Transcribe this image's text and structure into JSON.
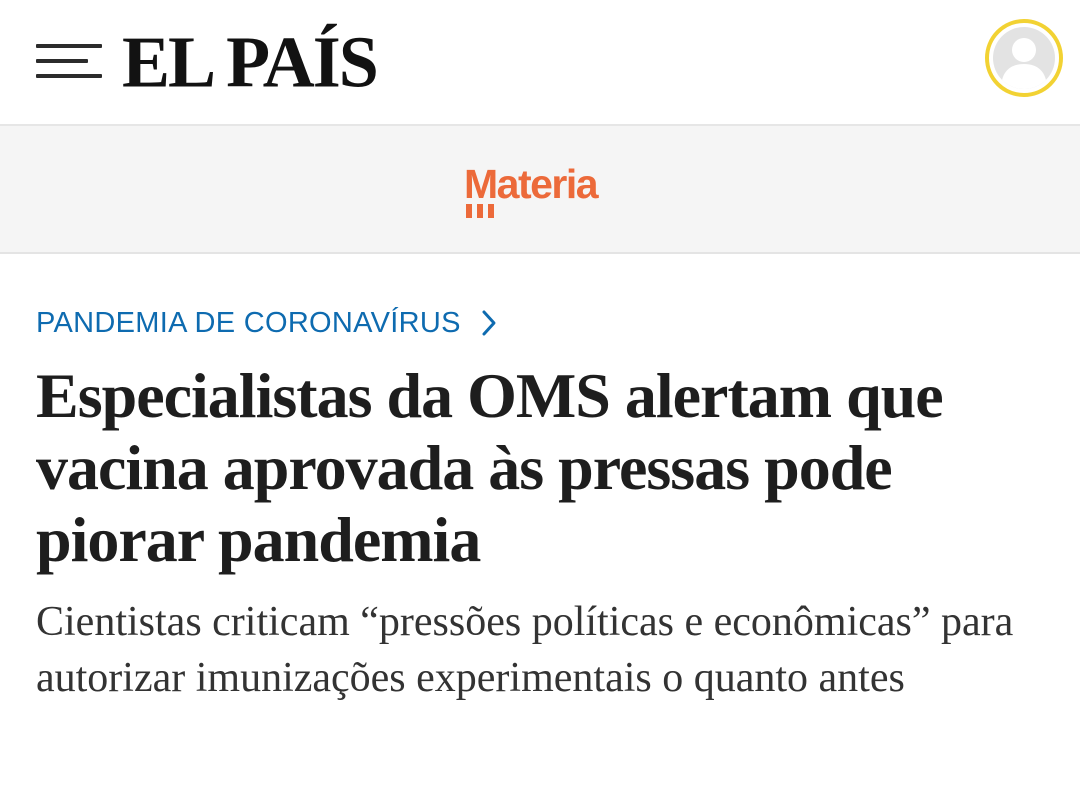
{
  "header": {
    "logo_text": "EL PAÍS",
    "menu_icon": "hamburger-menu-icon",
    "avatar_icon": "user-avatar-icon",
    "colors": {
      "avatar_ring": "#f2d233"
    }
  },
  "section_band": {
    "label": "Materia",
    "color": "#ec6a3a"
  },
  "article": {
    "kicker": "PANDEMIA DE CORONAVÍRUS",
    "kicker_color": "#0e6bb0",
    "kicker_icon": "chevron-right-icon",
    "headline": "Especialistas da OMS alertam que vacina aprovada às pressas pode piorar pandemia",
    "subheadline": "Cientistas criticam “pressões políticas e econômicas” para autorizar imunizações experimentais o quanto antes"
  }
}
